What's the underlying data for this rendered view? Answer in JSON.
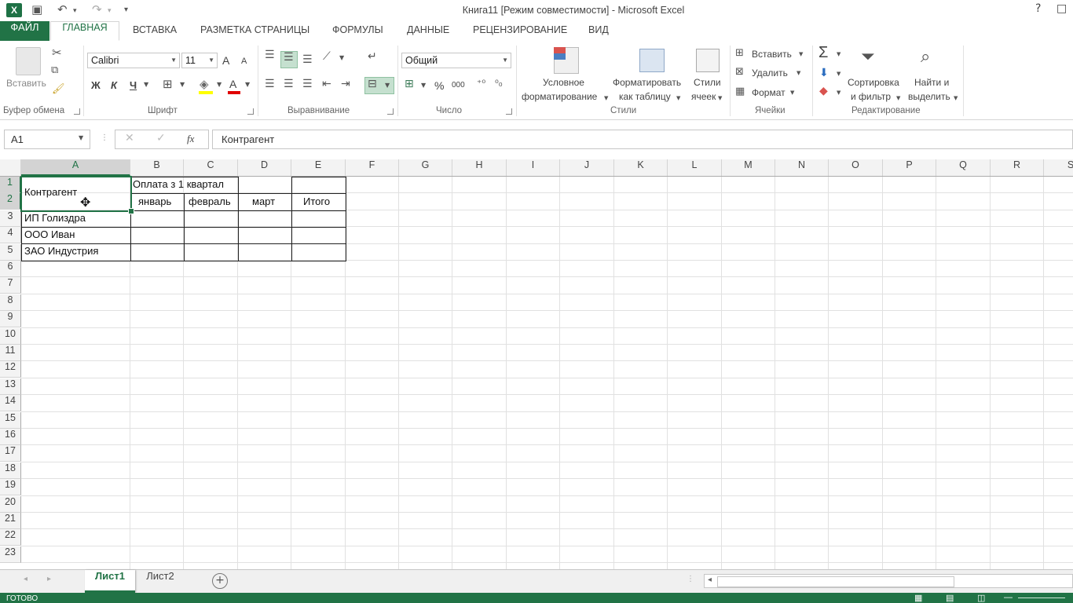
{
  "window": {
    "title": "Книга11  [Режим совместимости] - Microsoft Excel",
    "help": "?",
    "restore": "□",
    "undo": "↶",
    "redo": "↷",
    "save": "💾",
    "qat_more": "▾",
    "app_icon": "X"
  },
  "tabs": [
    "ФАЙЛ",
    "ГЛАВНАЯ",
    "ВСТАВКА",
    "РАЗМЕТКА СТРАНИЦЫ",
    "ФОРМУЛЫ",
    "ДАННЫЕ",
    "РЕЦЕНЗИРОВАНИЕ",
    "ВИД"
  ],
  "ribbon": {
    "clipboard": {
      "paste": "Вставить",
      "label": "Буфер обмена"
    },
    "font": {
      "name": "Calibri",
      "size": "11",
      "bold": "Ж",
      "italic": "К",
      "underline": "Ч",
      "grow": "A",
      "shrink": "A",
      "font_color": "A",
      "label": "Шрифт"
    },
    "alignment": {
      "label": "Выравнивание"
    },
    "number": {
      "format": "Общий",
      "percent": "%",
      "thousands": "000",
      "label": "Число"
    },
    "styles": {
      "conditional": [
        "Условное",
        "форматирование"
      ],
      "format_table": [
        "Форматировать",
        "как таблицу"
      ],
      "cell_styles": [
        "Стили",
        "ячеек"
      ],
      "label": "Стили"
    },
    "cells": {
      "insert": "Вставить",
      "delete": "Удалить",
      "format": "Формат",
      "label": "Ячейки"
    },
    "editing": {
      "sum": "Σ",
      "sort": [
        "Сортировка",
        "и фильтр"
      ],
      "find": [
        "Найти и",
        "выделить"
      ],
      "label": "Редактирование"
    }
  },
  "formula_bar": {
    "name_box": "A1",
    "fx": "fx",
    "formula": "Контрагент"
  },
  "columns": [
    "A",
    "B",
    "C",
    "D",
    "E",
    "F",
    "G",
    "H",
    "I",
    "J",
    "K",
    "L",
    "M",
    "N",
    "O",
    "P",
    "Q",
    "R",
    "S"
  ],
  "rows": [
    "1",
    "2",
    "3",
    "4",
    "5",
    "6",
    "7",
    "8",
    "9",
    "10",
    "11",
    "12",
    "13",
    "14",
    "15",
    "16",
    "17",
    "18",
    "19",
    "20",
    "21",
    "22",
    "23"
  ],
  "cells": {
    "A1": "Контрагент",
    "B1": "Оплата з 1 квартал",
    "B2": "январь",
    "C2": "февраль",
    "D2": "март",
    "E2": "Итого",
    "A3": "ИП Голиздра",
    "A4": "ООО Иван",
    "A5": "ЗАО Индустрия"
  },
  "sheets": [
    "Лист1",
    "Лист2"
  ],
  "active_sheet": "Лист1",
  "status": "ГОТОВО",
  "colors": {
    "accent": "#217346"
  }
}
